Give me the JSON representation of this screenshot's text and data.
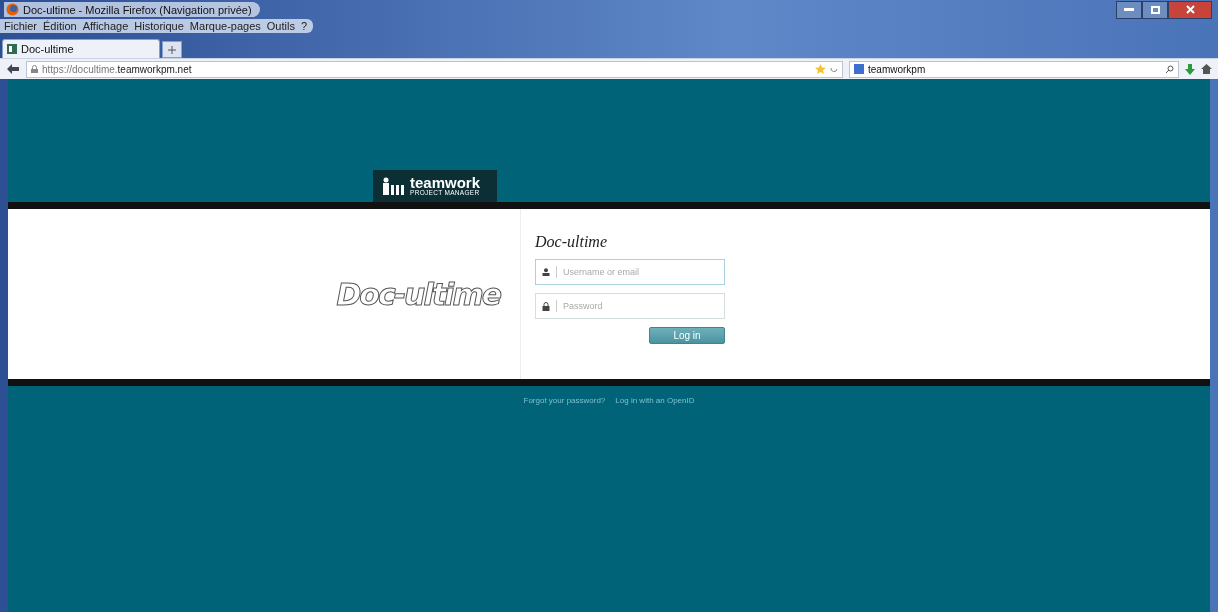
{
  "window": {
    "title": "Doc-ultime - Mozilla Firefox (Navigation privée)"
  },
  "menu": [
    "Fichier",
    "Édition",
    "Affichage",
    "Historique",
    "Marque-pages",
    "Outils",
    "?"
  ],
  "tabs": [
    {
      "label": "Doc-ultime",
      "selected": true
    }
  ],
  "address": {
    "prefix": "https://docultime.",
    "domain": "teamworkpm.net"
  },
  "search": {
    "value": "teamworkpm"
  },
  "header": {
    "logo": "teamwork",
    "logo_sub": "PROJECT MANAGER"
  },
  "login": {
    "brand": "Doc-ultime",
    "title": "Doc-ultime",
    "fields": [
      {
        "kind": "user",
        "placeholder": "Username or email"
      },
      {
        "kind": "password",
        "placeholder": "Password"
      }
    ],
    "button": "Log in"
  },
  "links": [
    "Forgot your password?",
    "Log in with an OpenID"
  ]
}
